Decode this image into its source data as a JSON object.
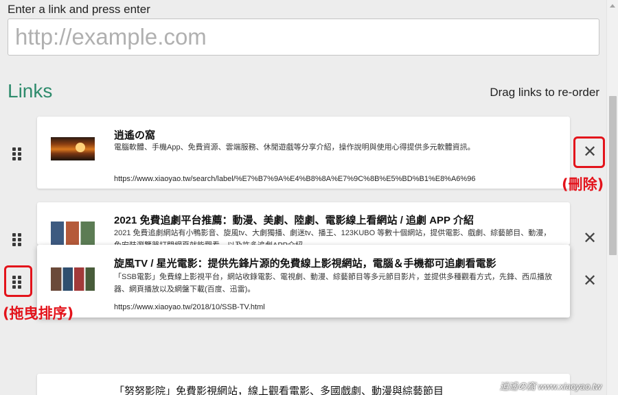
{
  "input": {
    "label": "Enter a link and press enter",
    "placeholder": "http://example.com"
  },
  "section": {
    "heading": "Links",
    "hint": "Drag links to re-order"
  },
  "cards": [
    {
      "title": "逍遙の窩",
      "description": "電腦軟體、手機App、免費資源、雲端服務、休閒遊戲等分享介紹，操作說明與使用心得提供多元軟體資訊。",
      "url": "https://www.xiaoyao.tw/search/label/%E7%B7%9A%E4%B8%8A%E7%9C%8B%E5%BD%B1%E8%A6%96"
    },
    {
      "title": "2021 免費追劇平台推薦：動漫、美劇、陸劇、電影線上看網站 / 追劇 APP 介紹",
      "description": "2021 免費追劇網站有小鴨影音、旋風tv、大劇獨播、劇迷tv、播王、123KUBO 等數十個網站，提供電影、戲劇、綜藝節目、動漫，免安裝瀏覽器打開網頁就能觀看，以及許多追劇APP介紹。"
    },
    {
      "title": "旋風TV / 星光電影：提供先鋒片源的免費線上影視網站，電腦＆手機都可追劇看電影",
      "description": "「SSB電影」免費線上影視平台，網站收錄電影、電視劇、動漫、綜藝節目等多元節目影片，並提供多種觀看方式，先鋒、西瓜播放器、網頁播放以及網盤下載(百度、迅雷)。",
      "url": "https://www.xiaoyao.tw/2018/10/SSB-TV.html"
    },
    {
      "title": "「努努影院」免費影視網站，線上觀看電影、多國戲劇、動漫與綜藝節目"
    }
  ],
  "annotations": {
    "delete": "(刪除)",
    "drag": "(拖曳排序)"
  },
  "watermark": "逍遙の窩 www.xiaoyao.tw",
  "colors": {
    "accent": "#2e8b6c",
    "annotation": "#e3131b",
    "background": "#ededed"
  },
  "icons": {
    "drag_handle": "grip-icon",
    "delete": "close-icon"
  }
}
